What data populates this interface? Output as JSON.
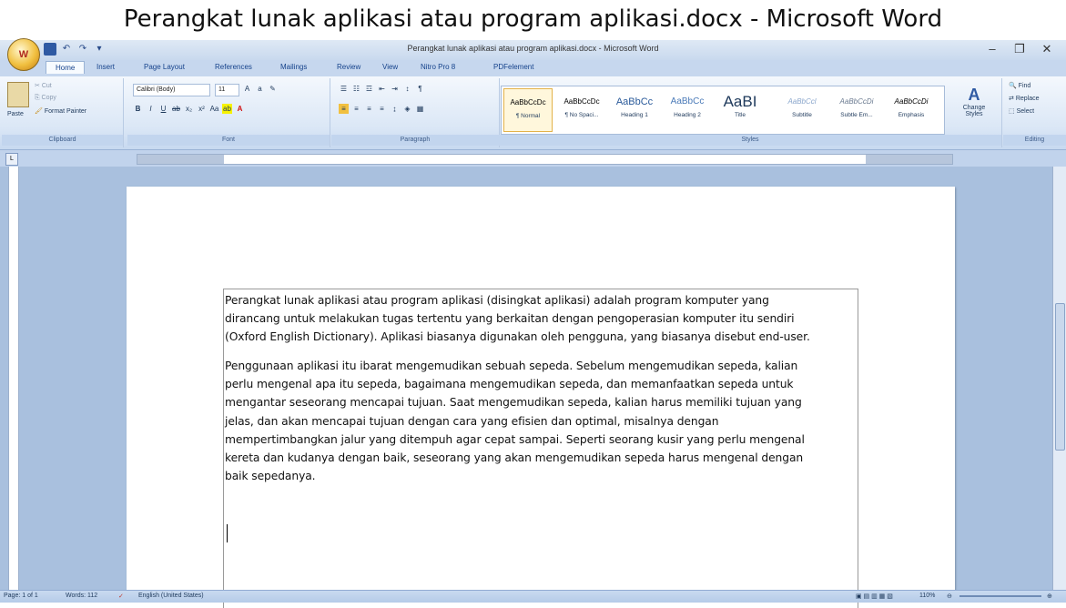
{
  "caption": "Perangkat lunak aplikasi atau program aplikasi.docx - Microsoft Word",
  "window": {
    "title": "Perangkat lunak aplikasi atau program aplikasi.docx - Microsoft Word"
  },
  "tabs": [
    "Home",
    "Insert",
    "Page Layout",
    "References",
    "Mailings",
    "Review",
    "View",
    "Nitro Pro 8",
    "PDFelement"
  ],
  "clipboard": {
    "paste": "Paste",
    "cut": "Cut",
    "copy": "Copy",
    "format_painter": "Format Painter",
    "label": "Clipboard"
  },
  "font": {
    "name": "Calibri (Body)",
    "size": "11",
    "label": "Font"
  },
  "paragraph": {
    "label": "Paragraph"
  },
  "styles": {
    "items": [
      {
        "sample": "AaBbCcDc",
        "name": "¶ Normal"
      },
      {
        "sample": "AaBbCcDc",
        "name": "¶ No Spaci..."
      },
      {
        "sample": "AaBbCc",
        "name": "Heading 1"
      },
      {
        "sample": "AaBbCc",
        "name": "Heading 2"
      },
      {
        "sample": "AaBI",
        "name": "Title"
      },
      {
        "sample": "AaBbCcl",
        "name": "Subtitle"
      },
      {
        "sample": "AaBbCcDi",
        "name": "Subtle Em..."
      },
      {
        "sample": "AaBbCcDi",
        "name": "Emphasis"
      }
    ],
    "label": "Styles",
    "change_styles": "Change Styles"
  },
  "editing": {
    "find": "Find",
    "replace": "Replace",
    "select": "Select",
    "label": "Editing"
  },
  "document": {
    "para1": [
      "Perangkat lunak aplikasi atau program aplikasi (disingkat aplikasi) adalah program komputer yang",
      "dirancang untuk melakukan tugas tertentu yang berkaitan dengan pengoperasian komputer itu sendiri",
      "(Oxford English Dictionary). Aplikasi biasanya digunakan oleh pengguna, yang biasanya disebut end-user."
    ],
    "para2": [
      "Penggunaan aplikasi itu ibarat mengemudikan sebuah sepeda. Sebelum mengemudikan sepeda, kalian",
      "perlu mengenal apa itu sepeda, bagaimana mengemudikan sepeda, dan memanfaatkan sepeda untuk",
      "mengantar seseorang  mencapai tujuan. Saat mengemudikan sepeda, kalian harus memiliki tujuan yang",
      "jelas, dan akan mencapai tujuan dengan cara yang efisien dan optimal, misalnya dengan",
      "mempertimbangkan jalur yang ditempuh agar cepat sampai. Seperti seorang kusir yang perlu mengenal",
      "kereta dan kudanya dengan baik, seseorang yang akan mengemudikan sepeda harus mengenal dengan",
      "baik sepedanya."
    ]
  },
  "status": {
    "page": "Page: 1 of 1",
    "words": "Words: 112",
    "language": "English (United States)",
    "zoom": "110%"
  }
}
